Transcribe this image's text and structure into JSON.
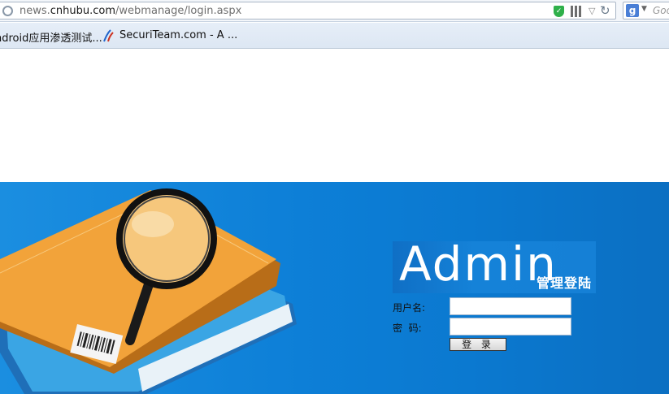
{
  "browser": {
    "url_prefix": "news.",
    "url_host": "cnhubu.com",
    "url_path": "/webmanage/login.aspx",
    "search_placeholder": "Goo",
    "search_engine_letter": "g",
    "security_icon": "shield-icon",
    "qr_icon": "qr-code-icon",
    "reload_icon": "reload-icon"
  },
  "bookmarks": [
    {
      "label": "ndroid应用渗透测试..."
    },
    {
      "label": "SecuriTeam.com - A ..."
    }
  ],
  "login": {
    "title_en": "Admin",
    "title_cn": "管理登陆",
    "username_label": "用户名:",
    "password_label": "密  码:",
    "submit_label": "登 录"
  },
  "colors": {
    "banner_blue": "#0d7fd7",
    "book_orange": "#f2a33a",
    "book_blue": "#3aa0dd"
  }
}
